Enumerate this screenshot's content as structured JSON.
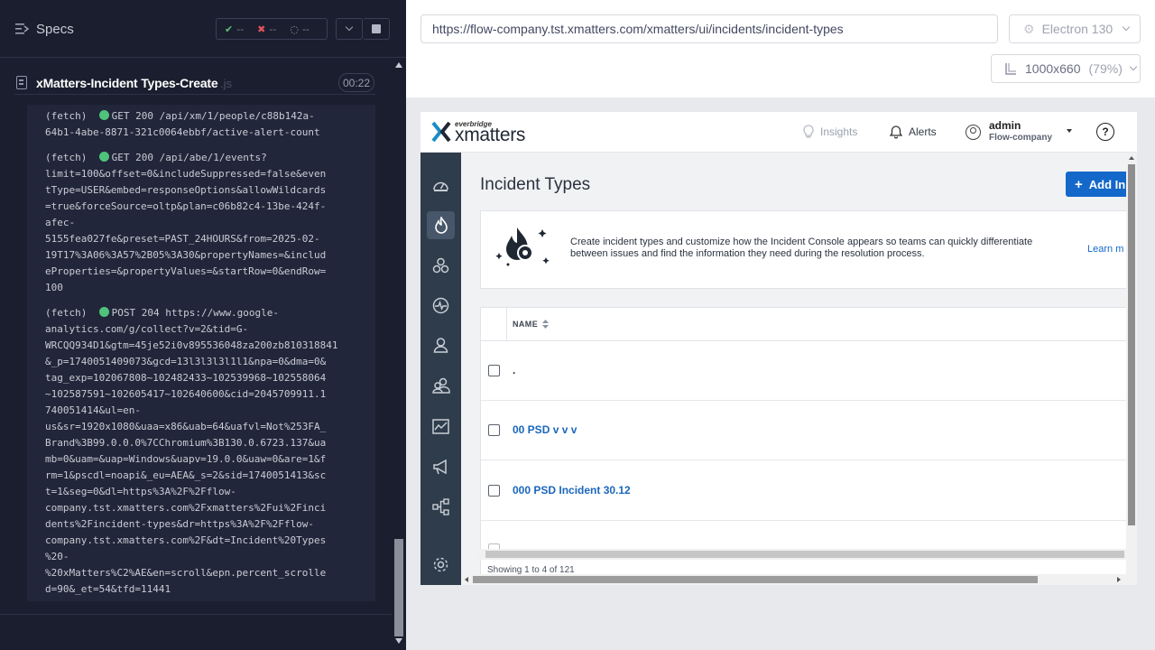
{
  "runner": {
    "specs_label": "Specs",
    "stats": {
      "passed": "--",
      "failed": "--",
      "pending": "--"
    },
    "spec": {
      "name": "xMatters-Incident Types-Create",
      "ext": ".js",
      "duration": "00:22"
    },
    "logs": [
      {
        "method": "(fetch)",
        "text": "GET 200 /api/xm/1/people/c88b142a-\n64b1-4abe-8871-321c0064ebbf/active-alert-count"
      },
      {
        "method": "(fetch)",
        "text": "GET 200 /api/abe/1/events?\nlimit=100&offset=0&includeSuppressed=false&even\ntType=USER&embed=responseOptions&allowWildcards\n=true&forceSource=oltp&plan=c06b82c4-13be-424f-\nafec-\n5155fea027fe&preset=PAST_24HOURS&from=2025-02-\n19T17%3A06%3A57%2B05%3A30&propertyNames=&includ\neProperties=&propertyValues=&startRow=0&endRow=\n100"
      },
      {
        "method": "(fetch)",
        "text": "POST 204 https://www.google-\nanalytics.com/g/collect?v=2&tid=G-\nWRCQQ934D1&gtm=45je52i0v895536048za200zb810318841\n&_p=1740051409073&gcd=13l3l3l3l1l1&npa=0&dma=0&\ntag_exp=102067808~102482433~102539968~102558064\n~102587591~102605417~102640600&cid=2045709911.1\n740051414&ul=en-\nus&sr=1920x1080&uaa=x86&uab=64&uafvl=Not%253FA_\nBrand%3B99.0.0.0%7CChromium%3B130.0.6723.137&ua\nmb=0&uam=&uap=Windows&uapv=19.0.0&uaw=0&are=1&f\nrm=1&pscdl=noapi&_eu=AEA&_s=2&sid=1740051413&sc\nt=1&seg=0&dl=https%3A%2F%2Fflow-\ncompany.tst.xmatters.com%2Fxmatters%2Fui%2Finci\ndents%2Fincident-types&dr=https%3A%2F%2Fflow-\ncompany.tst.xmatters.com%2F&dt=Incident%20Types\n%20-\n%20xMatters%C2%AE&en=scroll&epn.percent_scrolle\nd=90&_et=54&tfd=11441"
      }
    ]
  },
  "browser": {
    "url": "https://flow-company.tst.xmatters.com/xmatters/ui/incidents/incident-types",
    "name": "Electron 130",
    "viewport": "1000x660",
    "zoom": "(79%)"
  },
  "app": {
    "brand_small": "everbridge",
    "brand_name": "xmatters",
    "header": {
      "insights": "Insights",
      "alerts": "Alerts",
      "user_name": "admin",
      "user_org": "Flow-company",
      "help": "?"
    },
    "page_title": "Incident Types",
    "add_button": "Add In",
    "intro_text": "Create incident types and customize how the Incident Console appears so teams can quickly differentiate between issues and find the information they need during the resolution process.",
    "intro_link": "Learn m",
    "table": {
      "column": "NAME",
      "rows": [
        ".",
        "00 PSD v v v",
        "000 PSD Incident 30.12"
      ]
    },
    "showing": "Showing 1 to 4 of 121"
  },
  "colors": {
    "runner_bg": "#1b1e2e",
    "nav_bg": "#2f3c4b",
    "primary": "#1468c9",
    "pass": "#4fc27c"
  }
}
